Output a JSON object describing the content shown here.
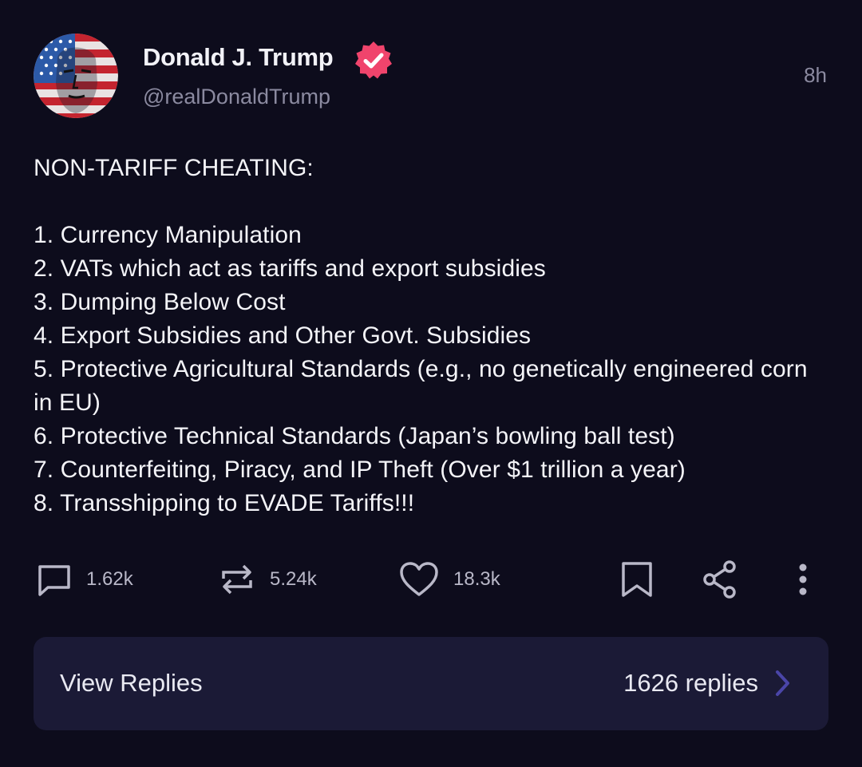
{
  "author": {
    "display_name": "Donald J. Trump",
    "handle": "@realDonaldTrump",
    "avatar_icon": "avatar-flag-portrait",
    "verified_icon": "verified-badge-icon",
    "verified_color": "#f0446c"
  },
  "post": {
    "time": "8h",
    "text": "NON-TARIFF CHEATING:\n\n1. Currency Manipulation\n2. VATs which act as tariffs and export subsidies\n3. Dumping Below Cost\n4. Export Subsidies and Other Govt. Subsidies\n5. Protective Agricultural Standards (e.g., no genetically engineered corn in EU)\n6. Protective Technical Standards (Japan’s bowling ball test)\n7. Counterfeiting, Piracy, and IP Theft (Over $1 trillion a year)\n8. Transshipping to EVADE Tariffs!!!"
  },
  "actions": {
    "reply_count": "1.62k",
    "repost_count": "5.24k",
    "like_count": "18.3k",
    "icons": [
      "comment-icon",
      "repost-icon",
      "heart-icon",
      "bookmark-icon",
      "share-icon",
      "more-vertical-icon"
    ]
  },
  "replies": {
    "label": "View Replies",
    "count_text": "1626 replies",
    "chevron_color": "#4a45a8"
  },
  "colors": {
    "background": "#0d0c1c",
    "card": "#1b1a36",
    "text": "#f4f4f8",
    "muted": "#8b8aa0"
  }
}
